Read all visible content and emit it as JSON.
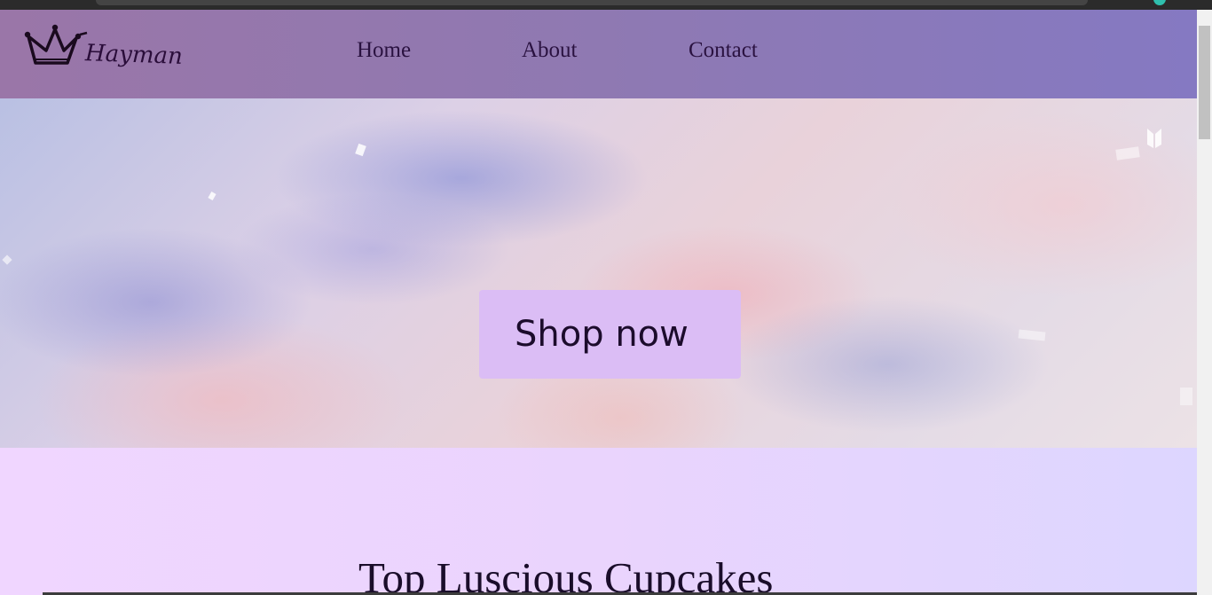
{
  "navbar": {
    "logo_text": "Hayman",
    "logo_icon": "crown-icon",
    "links": [
      {
        "label": "Home"
      },
      {
        "label": "About"
      },
      {
        "label": "Contact"
      }
    ]
  },
  "hero": {
    "cta_label": "Shop now"
  },
  "section": {
    "title": "Top Luscious Cupcakes"
  },
  "colors": {
    "navbar_start": "#9a76a8",
    "navbar_end": "#8579c2",
    "button_bg": "#dbbdf5",
    "text_dark": "#2a1240",
    "section_bg_start": "#f0d6ff",
    "section_bg_end": "#ddd6ff"
  }
}
